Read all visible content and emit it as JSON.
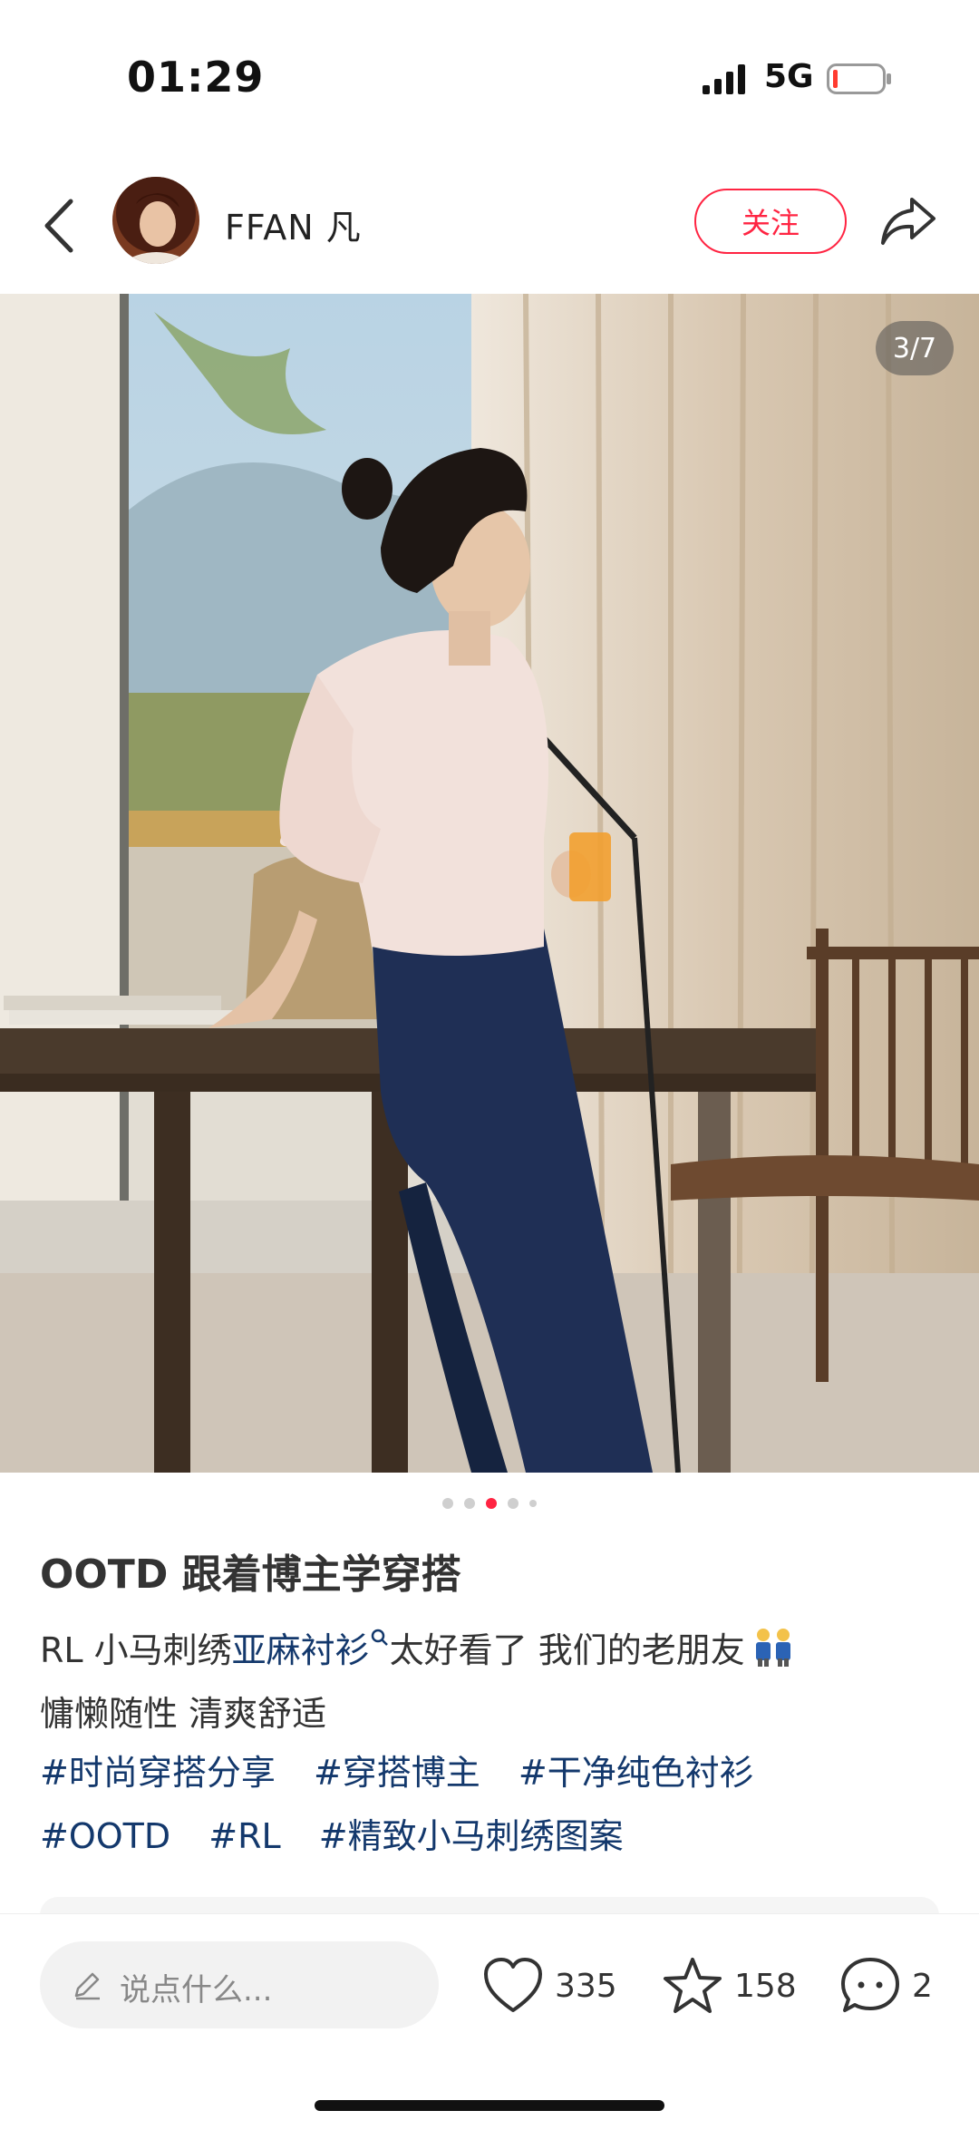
{
  "status": {
    "time": "01:29",
    "network": "5G"
  },
  "header": {
    "author": "FFAN 凡",
    "follow_label": "关注"
  },
  "photo": {
    "counter": "3/7",
    "slide_count": 5,
    "active_slide": 3
  },
  "post": {
    "title": "OOTD 跟着博主学穿搭",
    "text_before": "RL 小马刺绣",
    "text_link": "亚麻衬衫",
    "text_after": "太好看了 我们的老朋友",
    "text_line2": "慵懒随性 清爽舒适",
    "tags": [
      "#时尚穿搭分享",
      "#穿搭博主",
      "#干净纯色衬衫",
      "#OOTD",
      "#RL",
      "#精致小马刺绣图案"
    ]
  },
  "bottom_bar": {
    "input_placeholder": "说点什么...",
    "likes": "335",
    "favorites": "158",
    "comments": "2"
  },
  "colors": {
    "accent": "#ff2442",
    "link": "#13386c"
  }
}
